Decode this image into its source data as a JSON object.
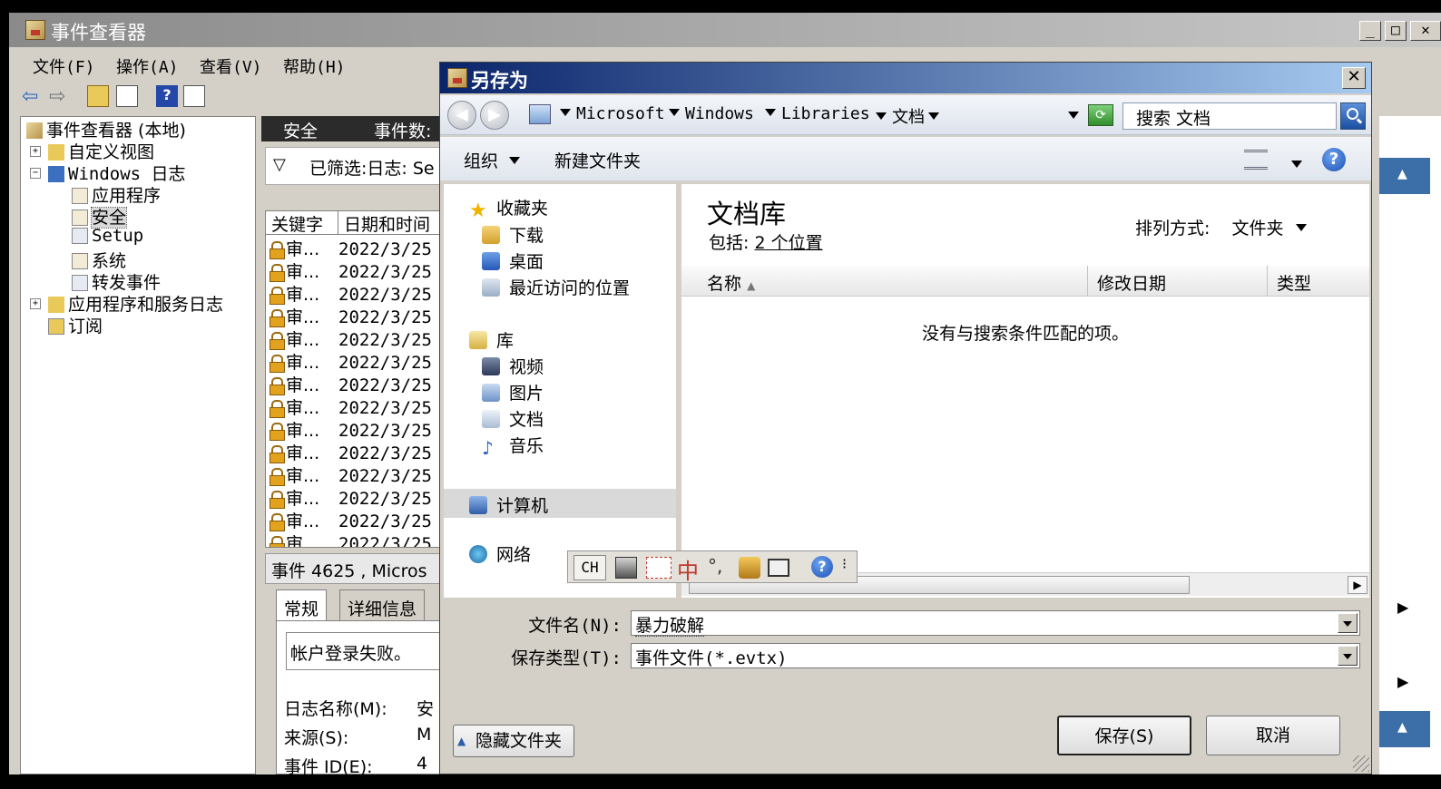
{
  "main_window": {
    "title": "事件查看器",
    "menu": [
      "文件(F)",
      "操作(A)",
      "查看(V)",
      "帮助(H)"
    ],
    "tree": {
      "root": "事件查看器 (本地)",
      "custom_views": "自定义视图",
      "windows_logs": "Windows 日志",
      "application": "应用程序",
      "security": "安全",
      "setup": "Setup",
      "system": "系统",
      "forwarded": "转发事件",
      "app_service_logs": "应用程序和服务日志",
      "subscriptions": "订阅"
    },
    "center": {
      "header_title": "安全",
      "header_count": "事件数:",
      "filter_text": "已筛选:日志: Se",
      "columns": [
        "关键字",
        "日期和时间"
      ],
      "rows": [
        {
          "keyword": "审...",
          "date": "2022/3/25"
        },
        {
          "keyword": "审...",
          "date": "2022/3/25"
        },
        {
          "keyword": "审...",
          "date": "2022/3/25"
        },
        {
          "keyword": "审...",
          "date": "2022/3/25"
        },
        {
          "keyword": "审...",
          "date": "2022/3/25"
        },
        {
          "keyword": "审...",
          "date": "2022/3/25"
        },
        {
          "keyword": "审...",
          "date": "2022/3/25"
        },
        {
          "keyword": "审...",
          "date": "2022/3/25"
        },
        {
          "keyword": "审...",
          "date": "2022/3/25"
        },
        {
          "keyword": "审...",
          "date": "2022/3/25"
        },
        {
          "keyword": "审...",
          "date": "2022/3/25"
        },
        {
          "keyword": "审...",
          "date": "2022/3/25"
        },
        {
          "keyword": "审...",
          "date": "2022/3/25"
        },
        {
          "keyword": "审...",
          "date": "2022/3/25"
        }
      ],
      "detail_title": "事件 4625 , Micros",
      "tabs": [
        "常规",
        "详细信息"
      ],
      "message": "帐户登录失败。",
      "fields": [
        {
          "label": "日志名称(M):",
          "value": "安"
        },
        {
          "label": "来源(S):",
          "value": "M"
        },
        {
          "label": "事件 ID(E):",
          "value": "4"
        }
      ]
    }
  },
  "dialog": {
    "title": "另存为",
    "close_label": "✕",
    "breadcrumbs": [
      "Microsoft",
      "Windows",
      "Libraries",
      "文档"
    ],
    "search_placeholder": "搜索 文档",
    "toolbar": {
      "organize": "组织",
      "new_folder": "新建文件夹"
    },
    "nav": {
      "favorites": "收藏夹",
      "downloads": "下载",
      "desktop": "桌面",
      "recent": "最近访问的位置",
      "libraries": "库",
      "videos": "视频",
      "pictures": "图片",
      "documents": "文档",
      "music": "音乐",
      "computer": "计算机",
      "network": "网络"
    },
    "library": {
      "title": "文档库",
      "includes_label": "包括:",
      "includes_value": "2 个位置",
      "sort_label": "排列方式:",
      "sort_value": "文件夹"
    },
    "columns": {
      "name": "名称",
      "modified": "修改日期",
      "type": "类型"
    },
    "empty_message": "没有与搜索条件匹配的项。",
    "ime": {
      "lang": "CH",
      "mode": "中",
      "punct": "°,"
    },
    "filename_label": "文件名(N):",
    "filename_value": "暴力破解",
    "filetype_label": "保存类型(T):",
    "filetype_value": "事件文件(*.evtx)",
    "hide_folders": "隐藏文件夹",
    "save": "保存(S)",
    "cancel": "取消"
  },
  "colors": {
    "dialog_title_start": "#0a246a",
    "dialog_title_end": "#a6caf0",
    "window_face": "#d4d0c8",
    "accent_blue": "#3c6ea8"
  }
}
